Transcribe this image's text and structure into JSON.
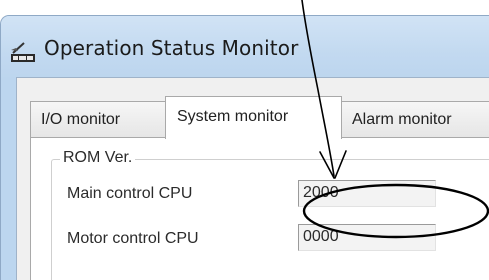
{
  "window": {
    "title": "Operation Status Monitor",
    "icon": "monitor-icon"
  },
  "tabs": [
    {
      "label": "I/O monitor",
      "selected": false
    },
    {
      "label": "System monitor",
      "selected": true
    },
    {
      "label": "Alarm monitor",
      "selected": false
    }
  ],
  "rom_group": {
    "legend": "ROM Ver.",
    "rows": [
      {
        "label": "Main control CPU",
        "value": "2000",
        "highlighted": true
      },
      {
        "label": "Motor control CPU",
        "value": "0000",
        "highlighted": false
      }
    ]
  },
  "annotation": {
    "arrow_icon": "pointer-arrow-icon",
    "highlight": "ellipse-highlight"
  },
  "colors": {
    "titlebar": "#c8dcf1",
    "client_bg": "#f0f0f0",
    "panel_bg": "#ffffff",
    "field_bg": "#f3f3f3",
    "annotation_stroke": "#000000"
  }
}
